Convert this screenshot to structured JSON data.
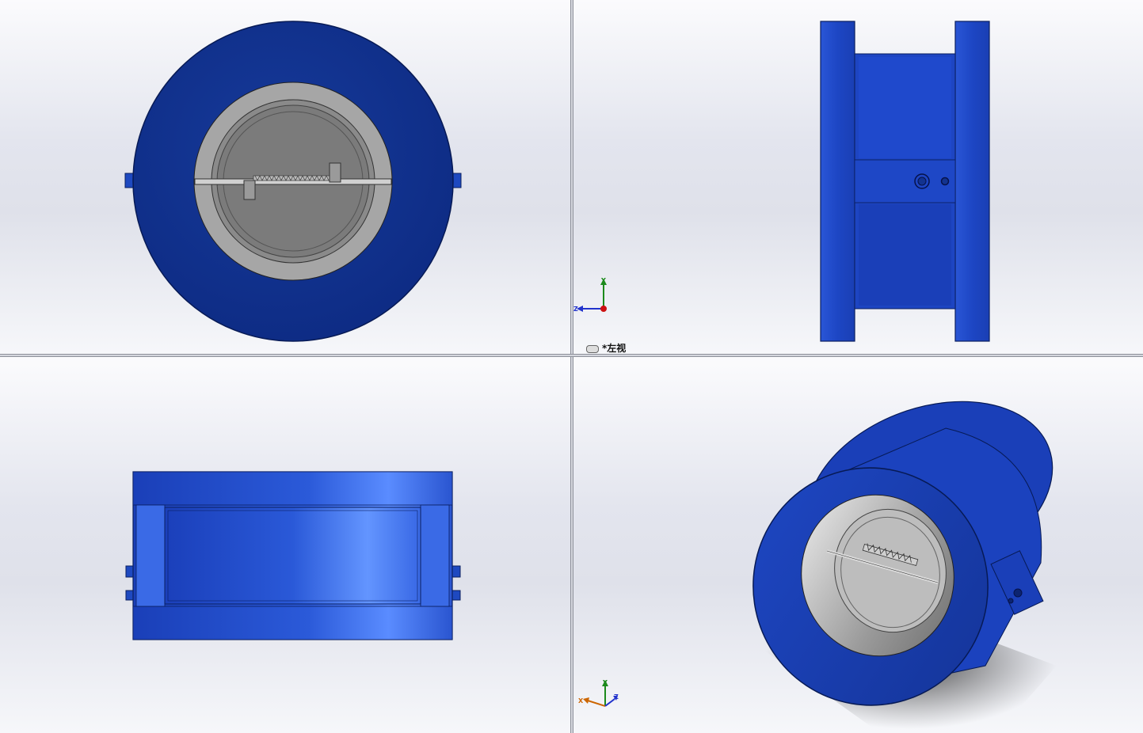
{
  "viewports": {
    "top_left": {
      "name": "front-view"
    },
    "top_right": {
      "name": "left-view",
      "label": "*左视",
      "triad": {
        "y": "Y",
        "z": "Z"
      }
    },
    "bottom_left": {
      "name": "top-view"
    },
    "bottom_right": {
      "name": "isometric-view",
      "triad": {
        "x": "X",
        "y": "Y",
        "z": "Z"
      }
    }
  },
  "colors": {
    "body_blue": "#1f3fb0",
    "body_dark": "#102a86",
    "body_light": "#5b8bff",
    "disc_grey": "#7a7a7a",
    "bore_grey": "#a9a9a9"
  },
  "icons": [
    "coordinate-triad-icon",
    "link-icon"
  ]
}
